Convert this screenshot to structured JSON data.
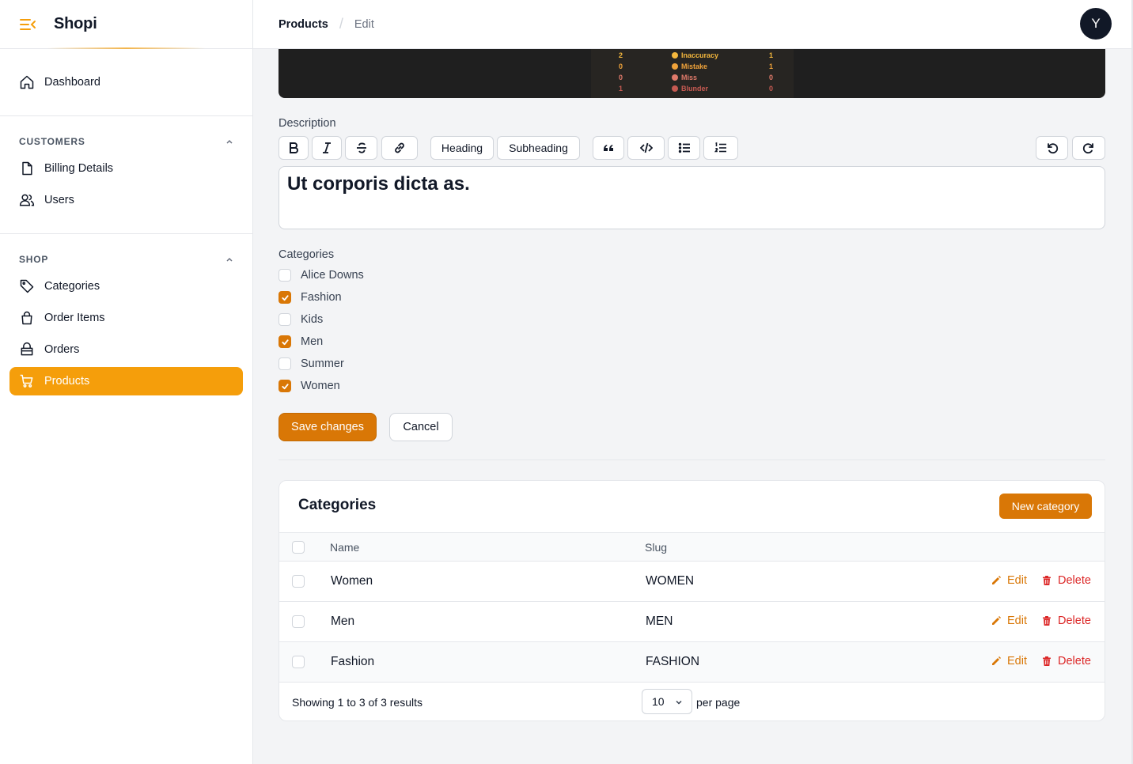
{
  "app": {
    "name": "Shopi",
    "avatar_initial": "Y"
  },
  "breadcrumb": {
    "parent": "Products",
    "separator": "/",
    "current": "Edit"
  },
  "sidebar": {
    "dashboard": "Dashboard",
    "groups": [
      {
        "label": "CUSTOMERS",
        "items": [
          "Billing Details",
          "Users"
        ]
      },
      {
        "label": "SHOP",
        "items": [
          "Categories",
          "Order Items",
          "Orders",
          "Products"
        ]
      }
    ],
    "active": "Products"
  },
  "image_preview": {
    "rows": [
      {
        "left": "2",
        "label": "Inaccuracy",
        "right": "1",
        "color": "#f5b83d"
      },
      {
        "left": "0",
        "label": "Mistake",
        "right": "1",
        "color": "#f0a33a"
      },
      {
        "left": "0",
        "label": "Miss",
        "right": "0",
        "color": "#e07a6a"
      },
      {
        "left": "1",
        "label": "Blunder",
        "right": "0",
        "color": "#c65a52"
      }
    ]
  },
  "form": {
    "description_label": "Description",
    "toolbar": {
      "heading": "Heading",
      "subheading": "Subheading"
    },
    "editor_content": "Ut corporis dicta as.",
    "categories_label": "Categories",
    "categories": [
      {
        "label": "Alice Downs",
        "checked": false
      },
      {
        "label": "Fashion",
        "checked": true
      },
      {
        "label": "Kids",
        "checked": false
      },
      {
        "label": "Men",
        "checked": true
      },
      {
        "label": "Summer",
        "checked": false
      },
      {
        "label": "Women",
        "checked": true
      }
    ],
    "save_label": "Save changes",
    "cancel_label": "Cancel"
  },
  "table": {
    "title": "Categories",
    "new_label": "New category",
    "columns": [
      "Name",
      "Slug"
    ],
    "rows": [
      {
        "name": "Women",
        "slug": "WOMEN"
      },
      {
        "name": "Men",
        "slug": "MEN"
      },
      {
        "name": "Fashion",
        "slug": "FASHION"
      }
    ],
    "edit_label": "Edit",
    "delete_label": "Delete",
    "footer": {
      "showing": "Showing 1 to 3 of 3 results",
      "per_page_value": "10",
      "per_page_label": "per page"
    }
  },
  "colors": {
    "accent": "#f59e0b",
    "primary_button": "#d97706",
    "danger": "#dc2626"
  }
}
